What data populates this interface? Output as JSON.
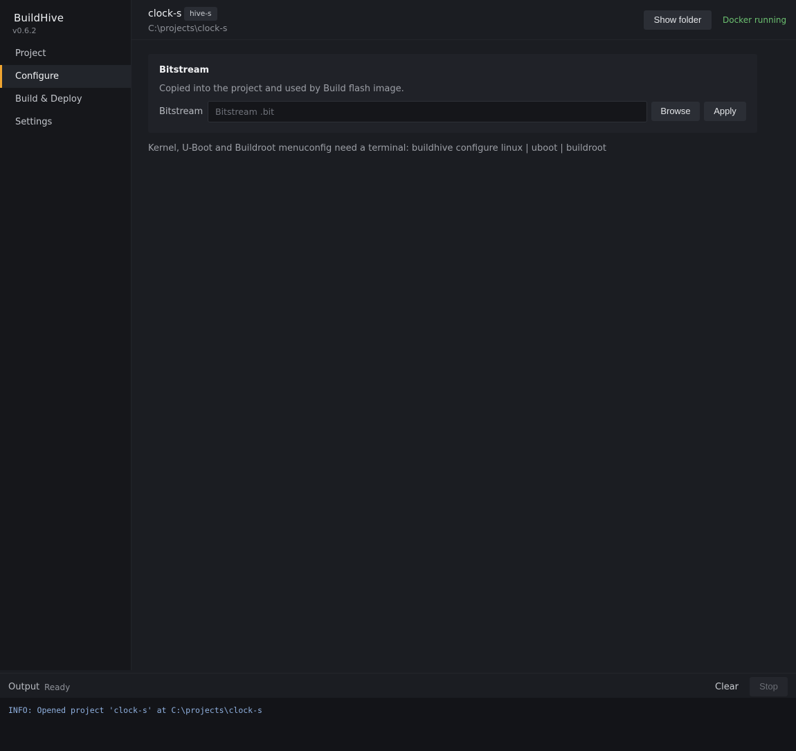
{
  "app": {
    "name": "BuildHive",
    "version": "v0.6.2"
  },
  "sidebar": {
    "items": [
      {
        "label": "Project",
        "active": false
      },
      {
        "label": "Configure",
        "active": true
      },
      {
        "label": "Build & Deploy",
        "active": false
      },
      {
        "label": "Settings",
        "active": false
      }
    ]
  },
  "header": {
    "project_name": "clock-s",
    "board_badge": "hive-s",
    "project_path": "C:\\projects\\clock-s",
    "show_folder_label": "Show folder",
    "docker_status": "Docker running"
  },
  "bitstream_card": {
    "title": "Bitstream",
    "description": "Copied into the project and used by Build flash image.",
    "field_label": "Bitstream",
    "input_value": "",
    "input_placeholder": "Bitstream .bit",
    "browse_label": "Browse",
    "apply_label": "Apply"
  },
  "hint": "Kernel, U-Boot and Buildroot menuconfig need a terminal: buildhive configure linux | uboot | buildroot",
  "output": {
    "label": "Output",
    "status": "Ready",
    "clear_label": "Clear",
    "stop_label": "Stop",
    "log_lines": [
      "INFO: Opened project 'clock-s' at C:\\projects\\clock-s"
    ]
  },
  "colors": {
    "accent": "#f0a531",
    "docker_ok": "#6cc070",
    "log_info": "#8fb0df"
  }
}
